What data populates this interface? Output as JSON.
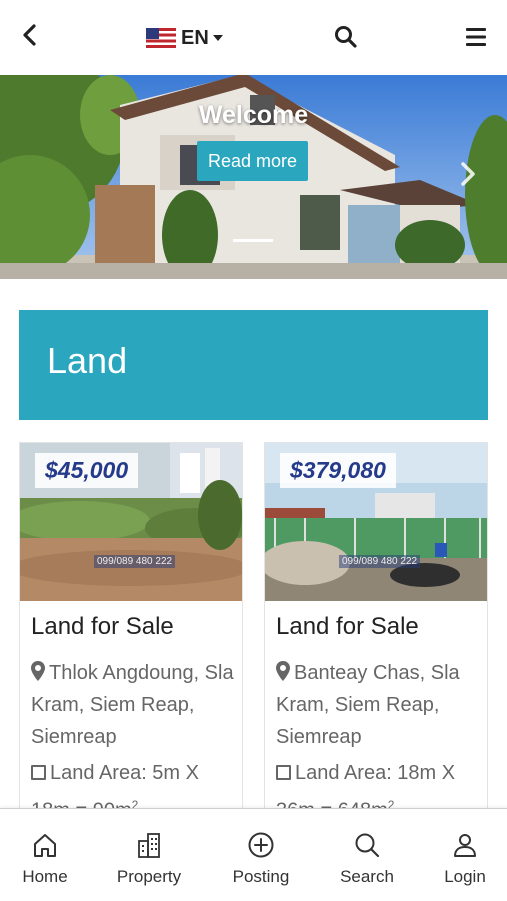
{
  "header": {
    "back_icon": "chevron-left-icon",
    "language_label": "EN",
    "flag_icon": "us-flag-icon",
    "search_icon": "search-icon",
    "menu_icon": "hamburger-menu-icon"
  },
  "hero": {
    "title": "Welcome",
    "button_label": "Read more",
    "next_icon": "chevron-right-icon"
  },
  "section": {
    "title": "Land",
    "accent_color": "#2aa6bf"
  },
  "listings": [
    {
      "price": "$45,000",
      "title": "Land for Sale",
      "location": "Thlok Angdoung, Sla Kram, Siem Reap, Siemreap",
      "area_prefix": "Land Area: 5m X 18m = 90m",
      "area_sup": "2",
      "watermark": "099/089 480 222"
    },
    {
      "price": "$379,080",
      "title": "Land for Sale",
      "location": "Banteay Chas, Sla Kram, Siem Reap, Siemreap",
      "area_prefix": "Land Area: 18m X 36m = 648m",
      "area_sup": "2",
      "watermark": "099/089 480 222"
    }
  ],
  "bottom_nav": {
    "items": [
      {
        "label": "Home",
        "icon": "home-icon"
      },
      {
        "label": "Property",
        "icon": "building-icon"
      },
      {
        "label": "Posting",
        "icon": "plus-circle-icon"
      },
      {
        "label": "Search",
        "icon": "search-icon"
      },
      {
        "label": "Login",
        "icon": "user-icon"
      }
    ]
  },
  "colors": {
    "accent": "#2aa6bf",
    "price_text": "#253a8a"
  }
}
